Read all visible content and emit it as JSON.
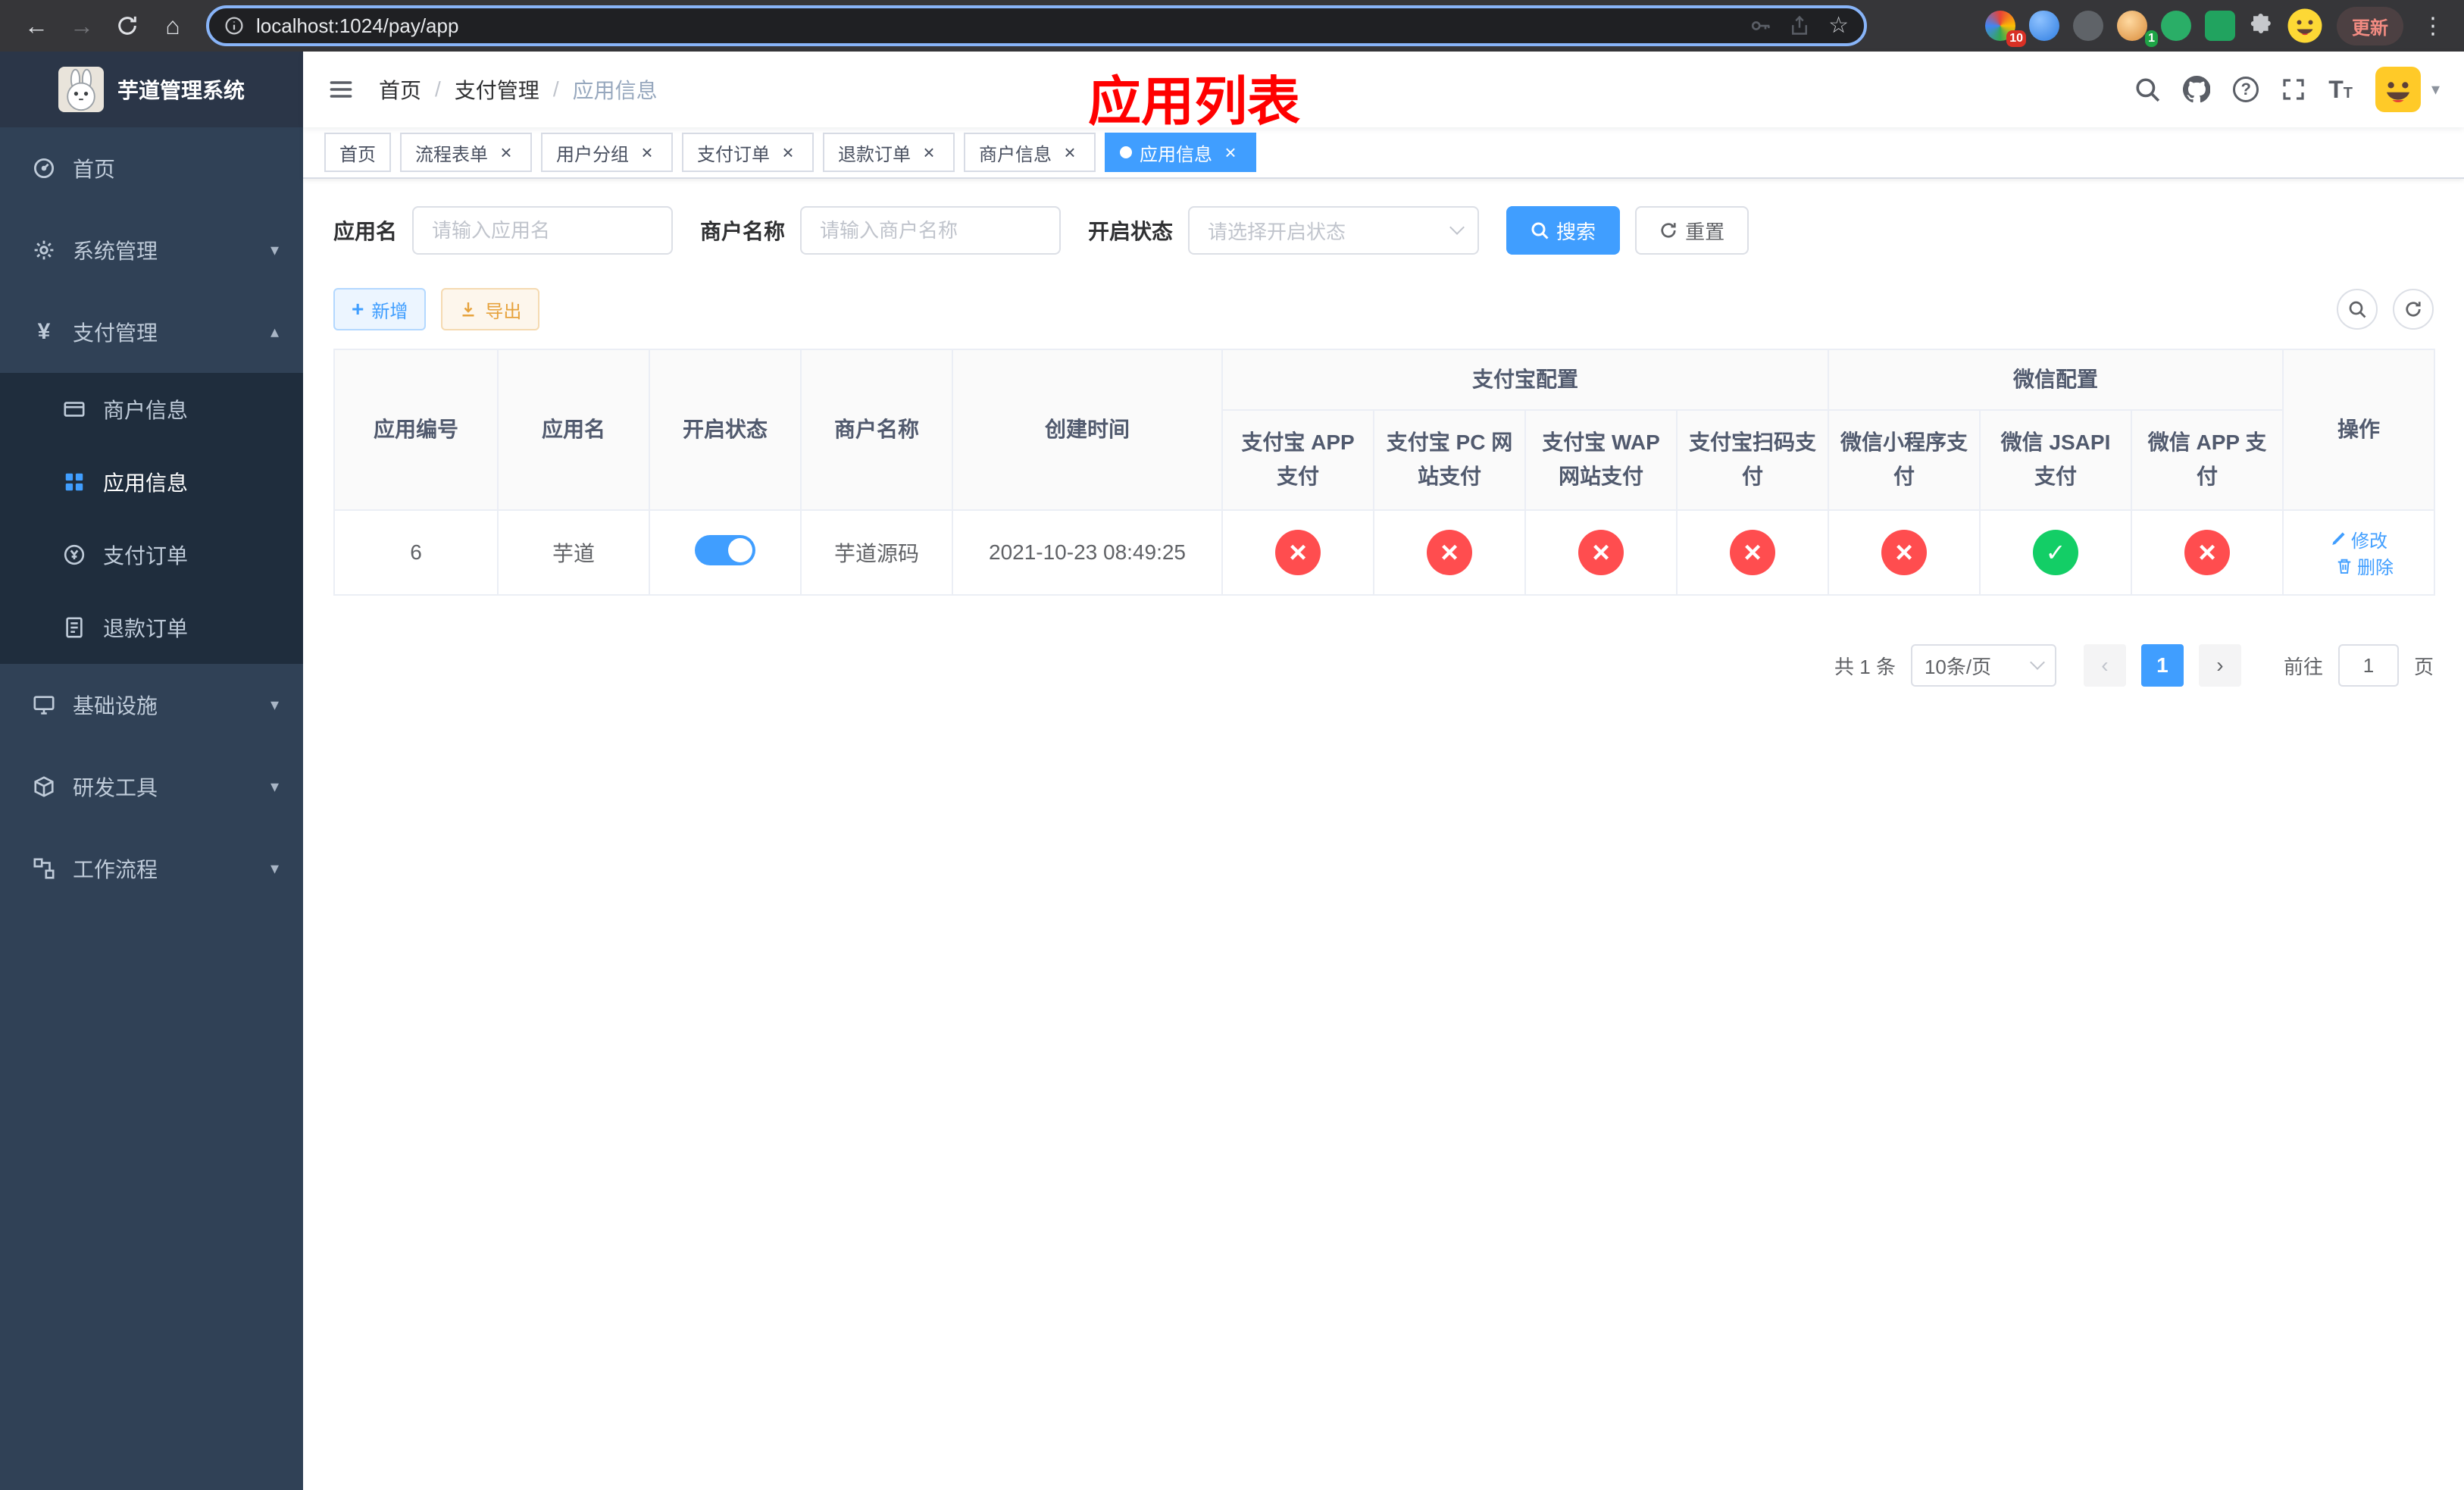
{
  "colors": {
    "primary": "#409eff",
    "success": "#13ce66",
    "danger": "#ff4d4f",
    "banner_red": "#ff0000",
    "sidebar_bg": "#304156",
    "submenu_bg": "#1f2d3d"
  },
  "icons": {
    "back": "←",
    "forward": "→",
    "home": "⌂",
    "star": "☆",
    "menu_dots": "⋮",
    "caret_down": "▾",
    "chevron_down": "▾",
    "chevron_up": "▴",
    "close": "×",
    "plus": "+",
    "yen": "¥",
    "question": "?",
    "prev": "‹",
    "next": "›",
    "font_size": "T"
  },
  "browser": {
    "url": "localhost:1024/pay/app",
    "update_label": "更新",
    "ext_badge_red": "10",
    "ext_badge_green": "1"
  },
  "sidebar": {
    "title": "芋道管理系统",
    "home": "首页",
    "system": "系统管理",
    "payment": "支付管理",
    "merchant_info": "商户信息",
    "app_info": "应用信息",
    "pay_order": "支付订单",
    "refund_order": "退款订单",
    "infra": "基础设施",
    "devtools": "研发工具",
    "workflow": "工作流程"
  },
  "breadcrumb": {
    "home": "首页",
    "payment": "支付管理",
    "current": "应用信息"
  },
  "banner": "应用列表",
  "tabs": [
    {
      "label": "首页"
    },
    {
      "label": "流程表单"
    },
    {
      "label": "用户分组"
    },
    {
      "label": "支付订单"
    },
    {
      "label": "退款订单"
    },
    {
      "label": "商户信息"
    },
    {
      "label": "应用信息"
    }
  ],
  "filters": {
    "app_name_label": "应用名",
    "app_name_placeholder": "请输入应用名",
    "merchant_label": "商户名称",
    "merchant_placeholder": "请输入商户名称",
    "status_label": "开启状态",
    "status_placeholder": "请选择开启状态",
    "search_label": "搜索",
    "reset_label": "重置"
  },
  "toolbar": {
    "add_label": "新增",
    "export_label": "导出"
  },
  "table": {
    "col_app_id": "应用编号",
    "col_app_name": "应用名",
    "col_status": "开启状态",
    "col_merchant": "商户名称",
    "col_created": "创建时间",
    "group_alipay": "支付宝配置",
    "group_wechat": "微信配置",
    "col_alipay_app": "支付宝 APP 支付",
    "col_alipay_pc": "支付宝 PC 网站支付",
    "col_alipay_wap": "支付宝 WAP 网站支付",
    "col_alipay_qr": "支付宝扫码支付",
    "col_wx_lite": "微信小程序支付",
    "col_wx_jsapi": "微信 JSAPI 支付",
    "col_wx_app": "微信 APP 支付",
    "col_actions": "操作",
    "row": {
      "app_id": "6",
      "app_name": "芋道",
      "status": "on",
      "merchant_name": "芋道源码",
      "created_at": "2021-10-23 08:49:25",
      "alipay_app": "off",
      "alipay_pc": "off",
      "alipay_wap": "off",
      "alipay_qr": "off",
      "wx_lite": "off",
      "wx_jsapi": "on",
      "wx_app": "off",
      "edit_label": "修改",
      "delete_label": "删除"
    }
  },
  "pagination": {
    "total": "共 1 条",
    "page_size": "10条/页",
    "page": "1",
    "goto_label": "前往",
    "goto_value": "1",
    "unit_label": "页"
  }
}
